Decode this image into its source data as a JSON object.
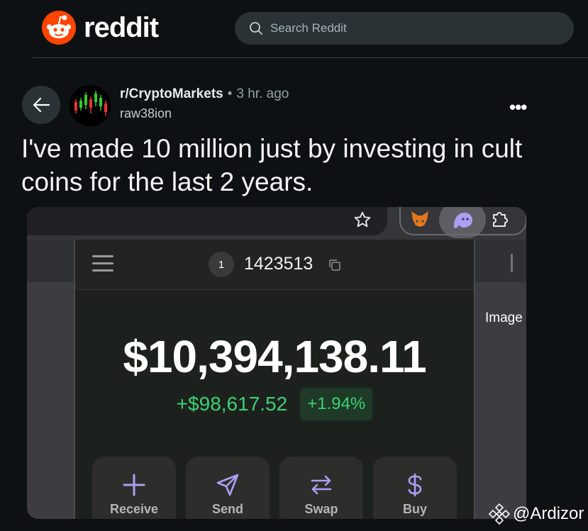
{
  "header": {
    "logo_text": "reddit",
    "search_placeholder": "Search Reddit"
  },
  "post": {
    "subreddit": "r/CryptoMarkets",
    "separator": "•",
    "time": "3 hr. ago",
    "author": "raw38ion",
    "title": "I've made 10 million just by investing in cult coins for the last 2 years.",
    "more_label": "•••",
    "media_badge": "Image"
  },
  "wallet": {
    "account_number": "1",
    "account_id": "1423513",
    "balance": "$10,394,138.11",
    "change_amount": "+$98,617.52",
    "change_percent": "+1.94%",
    "change_color": "#3ad273",
    "actions": [
      {
        "label": "Receive",
        "icon": "plus-icon"
      },
      {
        "label": "Send",
        "icon": "send-icon"
      },
      {
        "label": "Swap",
        "icon": "swap-icon"
      },
      {
        "label": "Buy",
        "icon": "dollar-icon"
      }
    ],
    "accent_color": "#ab9ff2"
  },
  "watermark": {
    "text": "@Ardizor"
  },
  "colors": {
    "background": "#0e1113",
    "reddit_orange": "#ff4500"
  }
}
